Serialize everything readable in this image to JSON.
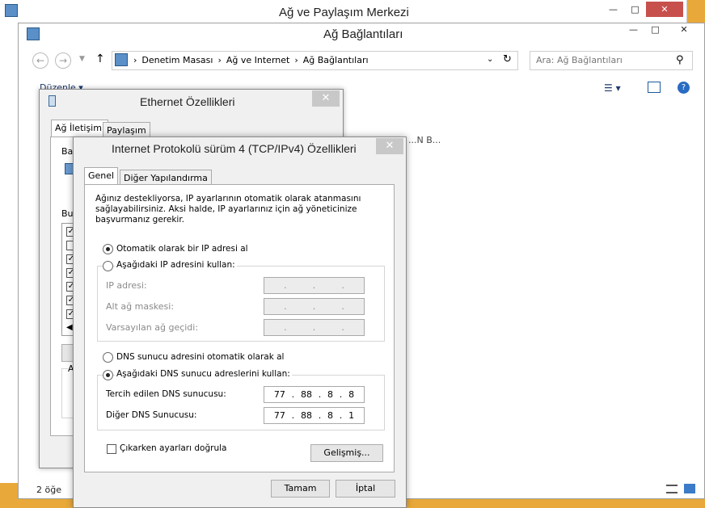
{
  "network_center": {
    "title": "Ağ ve Paylaşım Merkezi"
  },
  "net_connections": {
    "title": "Ağ Bağlantıları",
    "breadcrumb": [
      "Denetim Masası",
      "Ağ ve Internet",
      "Ağ Bağlantıları"
    ],
    "search_placeholder": "Ara: Ağ Bağlantıları",
    "organize_label": "Düzenle ▾",
    "item_count": "2 öğe",
    "partial_text": "...N B..."
  },
  "ethernet": {
    "title": "Ethernet Özellikleri",
    "tabs": [
      "Ağ İletişimi",
      "Paylaşım"
    ],
    "partial_labels": [
      "Ba",
      "Bu",
      "A"
    ]
  },
  "ipv4": {
    "title": "Internet Protokolü sürüm 4 (TCP/IPv4) Özellikleri",
    "tabs": [
      "Genel",
      "Diğer Yapılandırma"
    ],
    "description": "Ağınız destekliyorsa, IP ayarlarının otomatik olarak atanmasını sağlayabilirsiniz. Aksi halde, IP ayarlarınız için ağ yöneticinize başvurmanız gerekir.",
    "ip_auto_label": "Otomatik olarak bir IP adresi al",
    "ip_manual_label": "Aşağıdaki IP adresini kullan:",
    "ip_address_label": "IP adresi:",
    "subnet_label": "Alt ağ maskesi:",
    "gateway_label": "Varsayılan ağ geçidi:",
    "dns_auto_label": "DNS sunucu adresini otomatik olarak al",
    "dns_manual_label": "Aşağıdaki DNS sunucu adreslerini kullan:",
    "preferred_dns_label": "Tercih edilen DNS sunucusu:",
    "alternate_dns_label": "Diğer DNS Sunucusu:",
    "preferred_dns": [
      "77",
      "88",
      "8",
      "8"
    ],
    "alternate_dns": [
      "77",
      "88",
      "8",
      "1"
    ],
    "validate_label": "Çıkarken ayarları doğrula",
    "advanced_button": "Gelişmiş...",
    "ok_button": "Tamam",
    "cancel_button": "İptal",
    "selected_ip_mode": "auto",
    "selected_dns_mode": "manual",
    "validate_checked": false
  },
  "colors": {
    "close_red": "#c7504d",
    "accent_orange": "#e8a93a",
    "title_bar": "#ffffff"
  }
}
